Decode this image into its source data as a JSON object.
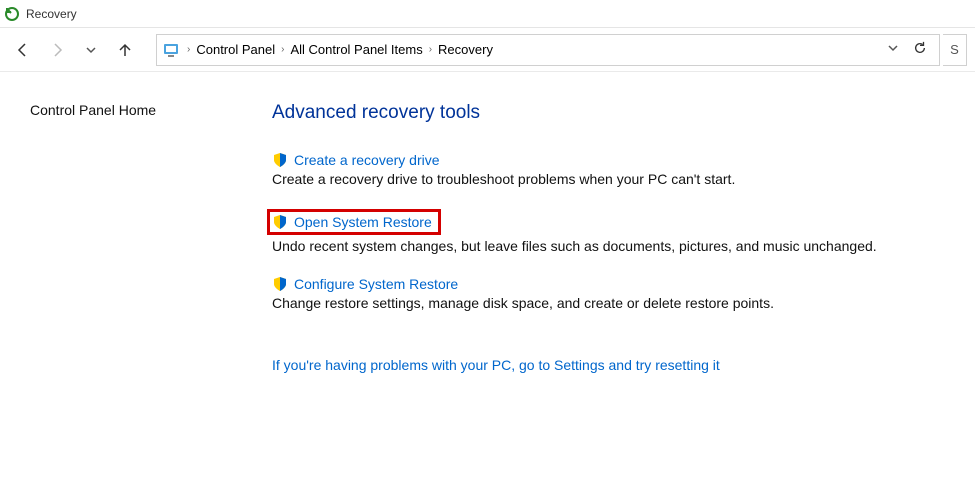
{
  "window": {
    "title": "Recovery"
  },
  "breadcrumb": {
    "items": [
      "Control Panel",
      "All Control Panel Items",
      "Recovery"
    ]
  },
  "search": {
    "placeholder": "S"
  },
  "sidebar": {
    "home_label": "Control Panel Home"
  },
  "main": {
    "heading": "Advanced recovery tools",
    "tools": [
      {
        "link": "Create a recovery drive",
        "desc": "Create a recovery drive to troubleshoot problems when your PC can't start."
      },
      {
        "link": "Open System Restore",
        "desc": "Undo recent system changes, but leave files such as documents, pictures, and music unchanged."
      },
      {
        "link": "Configure System Restore",
        "desc": "Change restore settings, manage disk space, and create or delete restore points."
      }
    ],
    "settings_link": "If you're having problems with your PC, go to Settings and try resetting it"
  }
}
